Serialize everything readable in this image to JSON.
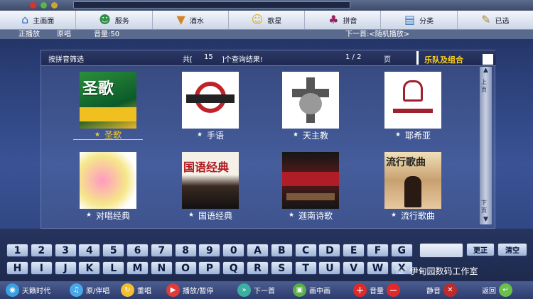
{
  "window": {
    "title": ""
  },
  "menu": [
    {
      "label": "主画面",
      "icon": "home-icon",
      "glyph": "⌂"
    },
    {
      "label": "服务",
      "icon": "service-icon",
      "glyph": "☻"
    },
    {
      "label": "酒水",
      "icon": "drinks-icon",
      "glyph": "🍹"
    },
    {
      "label": "歌星",
      "icon": "singer-icon",
      "glyph": "☺"
    },
    {
      "label": "拼音",
      "icon": "pinyin-icon",
      "glyph": "♣"
    },
    {
      "label": "分类",
      "icon": "category-icon",
      "glyph": "▤"
    },
    {
      "label": "已选",
      "icon": "selected-icon",
      "glyph": "✎"
    }
  ],
  "status": {
    "now_playing_label": "正播放",
    "vocal_label": "原唱",
    "volume_label": "音量:50",
    "next_label": "下一首:<随机播放>"
  },
  "results": {
    "mode_label": "按拼音筛选",
    "total_prefix": "共[",
    "total_count": "15",
    "total_suffix": "]个查询结果!",
    "page": "1 / 2",
    "page_unit": "页",
    "category": "乐队及组合"
  },
  "tiles": [
    {
      "label": "圣歌",
      "cover_text": "圣歌",
      "selected": true
    },
    {
      "label": "手语",
      "cover_text": "",
      "selected": false
    },
    {
      "label": "天主教",
      "cover_text": "",
      "selected": false
    },
    {
      "label": "耶希亚",
      "cover_text": "",
      "selected": false
    },
    {
      "label": "对唱经典",
      "cover_text": "",
      "selected": false
    },
    {
      "label": "国语经典",
      "cover_text": "国语经典",
      "selected": false
    },
    {
      "label": "迦南诗歌",
      "cover_text": "",
      "selected": false
    },
    {
      "label": "流行歌曲",
      "cover_text": "流行歌曲",
      "selected": false
    }
  ],
  "scrollbar": {
    "up": "上页",
    "down": "下页"
  },
  "keyboard": {
    "row1": [
      "1",
      "2",
      "3",
      "4",
      "5",
      "6",
      "7",
      "8",
      "9",
      "0",
      "A",
      "B",
      "C",
      "D",
      "E",
      "F",
      "G"
    ],
    "row2": [
      "H",
      "I",
      "J",
      "K",
      "L",
      "M",
      "N",
      "O",
      "P",
      "Q",
      "R",
      "S",
      "T",
      "U",
      "V",
      "W",
      "X"
    ],
    "input_value": "",
    "correct_label": "更正",
    "clear_label": "清空"
  },
  "footer": {
    "brand": "天籁时代",
    "vocal_toggle": "原/伴唱",
    "replay": "重唱",
    "play_pause": "播放/暂停",
    "next": "下一首",
    "screen": "画中画",
    "volume": "音量",
    "mute": "静音",
    "back": "返回"
  },
  "watermark": "伊甸园数码工作室"
}
